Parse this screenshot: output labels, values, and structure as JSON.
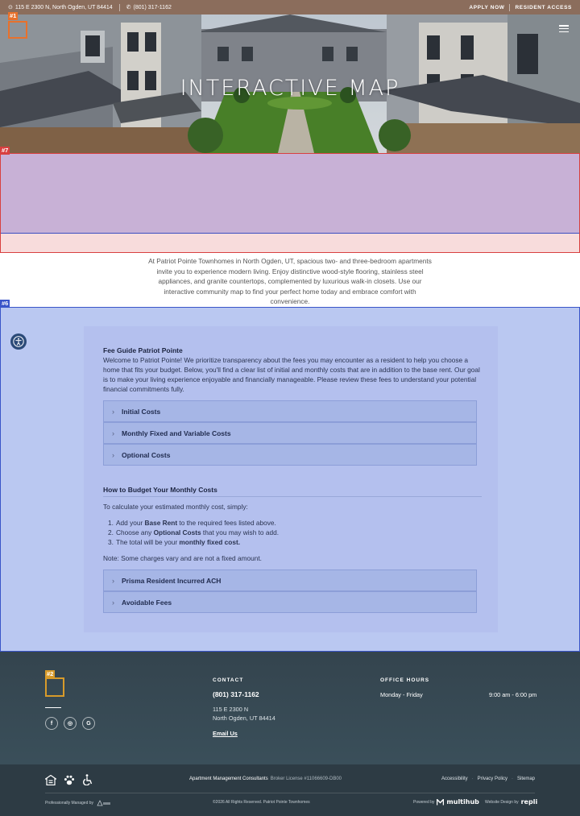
{
  "topbar": {
    "address": "115 E 2300 N, North Ogden, UT 84414",
    "phone": "(801) 317-1162",
    "apply_label": "APPLY NOW",
    "resident_label": "RESIDENT ACCESS"
  },
  "hero": {
    "title": "INTERACTIVE MAP"
  },
  "intro": {
    "text": "At Patriot Pointe Townhomes in North Ogden, UT, spacious two- and three-bedroom apartments invite you to experience modern living. Enjoy distinctive wood-style flooring, stainless steel appliances, and granite countertops, complemented by luxurious walk-in closets. Use our interactive community map to find your perfect home today and embrace comfort with convenience."
  },
  "fee_guide": {
    "title": "Fee Guide Patriot Pointe",
    "description": "Welcome to Patriot Pointe! We prioritize transparency about the fees you may encounter as a resident to help you choose a home that fits your budget. Below, you'll find a clear list of initial and monthly costs that are in addition to the base rent. Our goal is to make your living experience enjoyable and financially manageable. Please review these fees to understand your potential financial commitments fully.",
    "sections": [
      "Initial Costs",
      "Monthly Fixed and Variable Costs",
      "Optional Costs"
    ]
  },
  "budget": {
    "title": "How to Budget Your Monthly Costs",
    "intro": "To calculate your estimated monthly cost, simply:",
    "steps": [
      {
        "num": "1.",
        "pre": "Add your ",
        "bold": "Base Rent",
        "post": " to the required fees listed above."
      },
      {
        "num": "2.",
        "pre": "Choose any ",
        "bold": "Optional Costs",
        "post": " that you may wish to add."
      },
      {
        "num": "3.",
        "pre": "The total will be your ",
        "bold": "monthly fixed cost.",
        "post": ""
      }
    ],
    "note": "Note: Some charges vary and are not a fixed amount.",
    "sections": [
      "Prisma Resident Incurred ACH",
      "Avoidable Fees"
    ]
  },
  "footer": {
    "contact_heading": "CONTACT",
    "phone": "(801) 317-1162",
    "address_line1": "115 E 2300 N",
    "address_line2": "North Ogden, UT 84414",
    "email_label": "Email Us",
    "hours_heading": "OFFICE HOURS",
    "hours_days": "Monday - Friday",
    "hours_time": "9:00 am - 6:00 pm",
    "social": [
      "facebook-icon",
      "instagram-icon",
      "google-icon"
    ]
  },
  "subfooter": {
    "company": "Apartment Management Consultants",
    "license": "Broker License #11066609-DB00",
    "links": [
      "Accessibility",
      "Privacy Policy",
      "Sitemap"
    ],
    "managed_by": "Professionally Managed by",
    "copyright": "©2026 All Rights Reserved. Patriot Pointe Townhomes",
    "powered_by": "Powered by",
    "powered_brand": "multihub",
    "design_by": "Website Design by",
    "design_brand": "repli"
  },
  "tags": {
    "t1": "#1",
    "t2": "#2",
    "t6": "#6",
    "t7": "#7"
  },
  "colors": {
    "topbar": "#8b6d5c",
    "footer": "#34444e",
    "accent_orange": "#e8712c",
    "tag_orange": "#e8712c",
    "tag_gold": "#d89b2a",
    "tag_red": "#d84040",
    "tag_blue": "#3a55c9"
  }
}
